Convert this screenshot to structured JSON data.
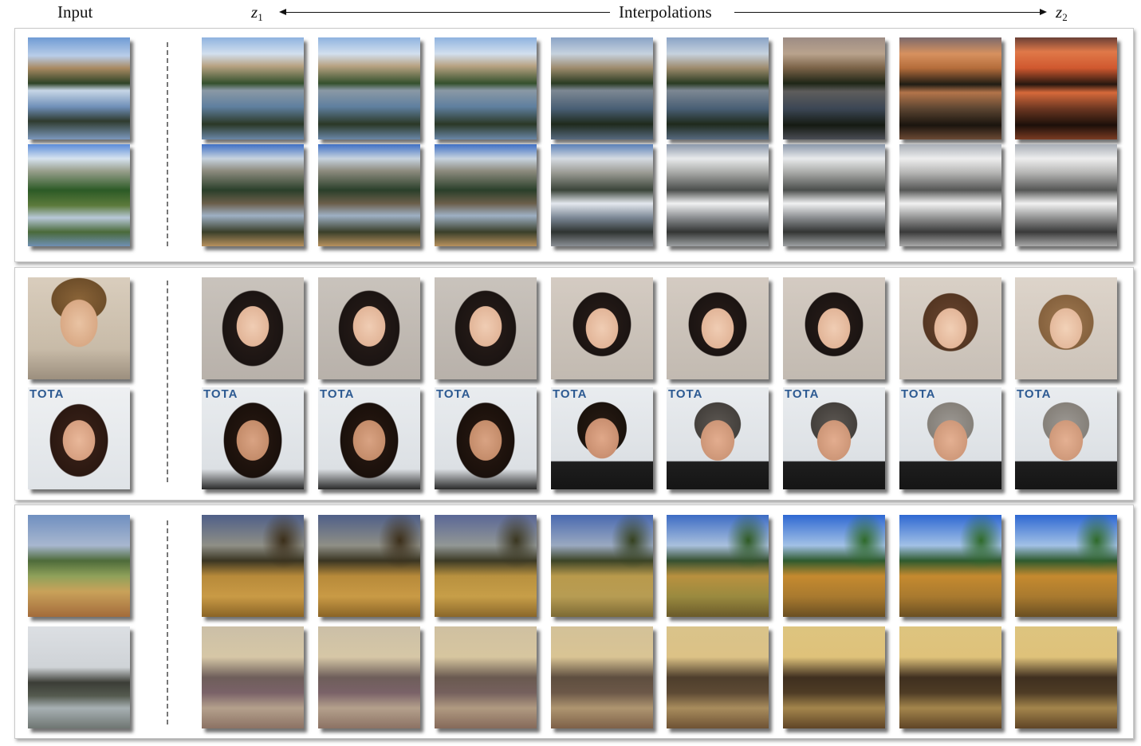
{
  "header": {
    "input_label": "Input",
    "z1_label": "z",
    "z1_sub": "1",
    "interp_label": "Interpolations",
    "z2_label": "z",
    "z2_sub": "2"
  },
  "overlay_text": "TOTA"
}
